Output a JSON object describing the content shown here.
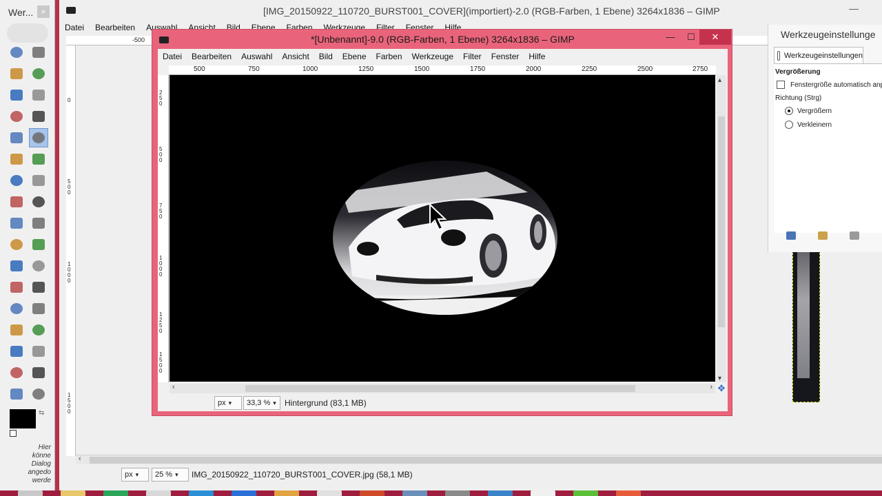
{
  "toolbox": {
    "title": "Wer...",
    "close": "×",
    "hint_lines": [
      "Hier",
      "könne",
      "Dialog",
      "angedo",
      "werde"
    ],
    "tools": [
      {
        "name": "rect-select-icon",
        "row": 0,
        "col": 0
      },
      {
        "name": "ellipse-select-icon",
        "row": 0,
        "col": 1
      },
      {
        "name": "free-select-icon",
        "row": 1,
        "col": 0
      },
      {
        "name": "fuzzy-select-icon",
        "row": 1,
        "col": 1
      },
      {
        "name": "select-by-color-icon",
        "row": 2,
        "col": 0
      },
      {
        "name": "scissors-select-icon",
        "row": 2,
        "col": 1
      },
      {
        "name": "foreground-select-icon",
        "row": 3,
        "col": 0
      },
      {
        "name": "paths-icon",
        "row": 3,
        "col": 1
      },
      {
        "name": "color-picker-icon",
        "row": 4,
        "col": 0
      },
      {
        "name": "zoom-tool-icon",
        "row": 4,
        "col": 1,
        "active": true
      },
      {
        "name": "measure-icon",
        "row": 5,
        "col": 0
      },
      {
        "name": "move-icon",
        "row": 5,
        "col": 1
      },
      {
        "name": "align-icon",
        "row": 6,
        "col": 0
      },
      {
        "name": "crop-icon",
        "row": 6,
        "col": 1
      },
      {
        "name": "rotate-icon",
        "row": 7,
        "col": 0
      },
      {
        "name": "scale-icon",
        "row": 7,
        "col": 1
      },
      {
        "name": "shear-icon",
        "row": 8,
        "col": 0
      },
      {
        "name": "perspective-icon",
        "row": 8,
        "col": 1
      },
      {
        "name": "flip-icon",
        "row": 9,
        "col": 0
      },
      {
        "name": "cage-transform-icon",
        "row": 9,
        "col": 1
      },
      {
        "name": "text-tool-icon",
        "row": 10,
        "col": 0
      },
      {
        "name": "bucket-fill-icon",
        "row": 10,
        "col": 1
      },
      {
        "name": "blend-icon",
        "row": 11,
        "col": 0
      },
      {
        "name": "pencil-icon",
        "row": 11,
        "col": 1
      },
      {
        "name": "paintbrush-icon",
        "row": 12,
        "col": 0
      },
      {
        "name": "eraser-icon",
        "row": 12,
        "col": 1
      },
      {
        "name": "airbrush-icon",
        "row": 13,
        "col": 0
      },
      {
        "name": "ink-icon",
        "row": 13,
        "col": 1
      },
      {
        "name": "clone-icon",
        "row": 14,
        "col": 0
      },
      {
        "name": "heal-icon",
        "row": 14,
        "col": 1
      },
      {
        "name": "perspective-clone-icon",
        "row": 15,
        "col": 0
      },
      {
        "name": "blur-icon",
        "row": 15,
        "col": 1
      },
      {
        "name": "smudge-icon",
        "row": 16,
        "col": 0
      },
      {
        "name": "dodge-burn-icon",
        "row": 16,
        "col": 1
      }
    ]
  },
  "background_window": {
    "title": "[IMG_20150922_110720_BURST001_COVER](importiert)-2.0 (RGB-Farben, 1 Ebene) 3264x1836 – GIMP",
    "menu": [
      "Datei",
      "Bearbeiten",
      "Auswahl",
      "Ansicht",
      "Bild",
      "Ebene",
      "Farben",
      "Werkzeuge",
      "Filter",
      "Fenster",
      "Hilfe"
    ],
    "ruler_h_label": "-500",
    "ruler_v_labels": [
      "0",
      "5 0 0",
      "1 0 0 0",
      "1 5 0 0"
    ],
    "status": {
      "unit": "px",
      "zoom": "25 %",
      "info": "IMG_20150922_110720_BURST001_COVER.jpg (58,1 MB)"
    }
  },
  "front_window": {
    "title": "*[Unbenannt]-9.0 (RGB-Farben, 1 Ebene) 3264x1836 – GIMP",
    "menu": [
      "Datei",
      "Bearbeiten",
      "Auswahl",
      "Ansicht",
      "Bild",
      "Ebene",
      "Farben",
      "Werkzeuge",
      "Filter",
      "Fenster",
      "Hilfe"
    ],
    "ruler_h_labels": [
      "500",
      "750",
      "1000",
      "1250",
      "1500",
      "1750",
      "2000",
      "2250",
      "2500",
      "2750"
    ],
    "ruler_v_labels": [
      "2 5 0",
      "5 0 0",
      "7 5 0",
      "1 0 0 0",
      "1 2 5 0",
      "1 5 0 0"
    ],
    "status": {
      "unit": "px",
      "zoom": "33,3 %",
      "layer": "Hintergrund (83,1 MB)"
    }
  },
  "dock": {
    "title": "Werkzeugeinstellunge",
    "tab_label": "Werkzeugeinstellungen",
    "section_title": "Vergrößerung",
    "checkbox_label": "Fenstergröße automatisch anpa",
    "direction_label": "Richtung (Strg)",
    "radio_options": [
      {
        "label": "Vergrößern",
        "checked": true
      },
      {
        "label": "Verkleinern",
        "checked": false
      }
    ]
  },
  "colors": {
    "front_border": "#e9647b",
    "close_button": "#c5324e",
    "toolbox_strip": "#b4344b",
    "taskbar": "#9f1d3e",
    "foreground": "#000000",
    "background": "#ffffff"
  }
}
